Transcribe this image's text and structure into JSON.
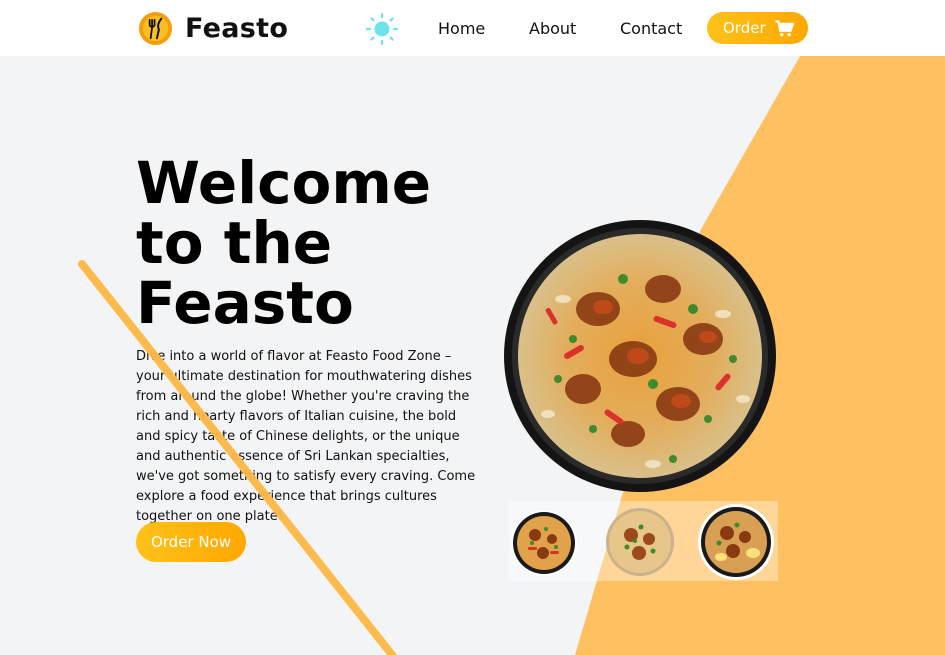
{
  "brand": {
    "name": "Feasto"
  },
  "nav": {
    "home": "Home",
    "about": "About",
    "contact": "Contact",
    "order": "Order"
  },
  "hero": {
    "title_line1": "Welcome",
    "title_line2": "to the",
    "title_line3": "Feasto",
    "description": "Dive into a world of flavor at Feasto Food Zone – your ultimate destination for mouthwatering dishes from around the globe! Whether you're craving the rich and hearty flavors of Italian cuisine, the bold and spicy taste of Chinese delights, or the unique and authentic essence of Sri Lankan specialties, we've got something to satisfy every craving. Come explore a food experience that brings cultures together on one plate!",
    "cta": "Order Now"
  },
  "colors": {
    "accent": "#ffb31a",
    "accent_light": "#ffc061",
    "background": "#f3f4f6",
    "theme_icon": "#6fe3ea"
  },
  "icons": [
    "logo-fork-knife-icon",
    "sun-icon",
    "cart-icon"
  ]
}
